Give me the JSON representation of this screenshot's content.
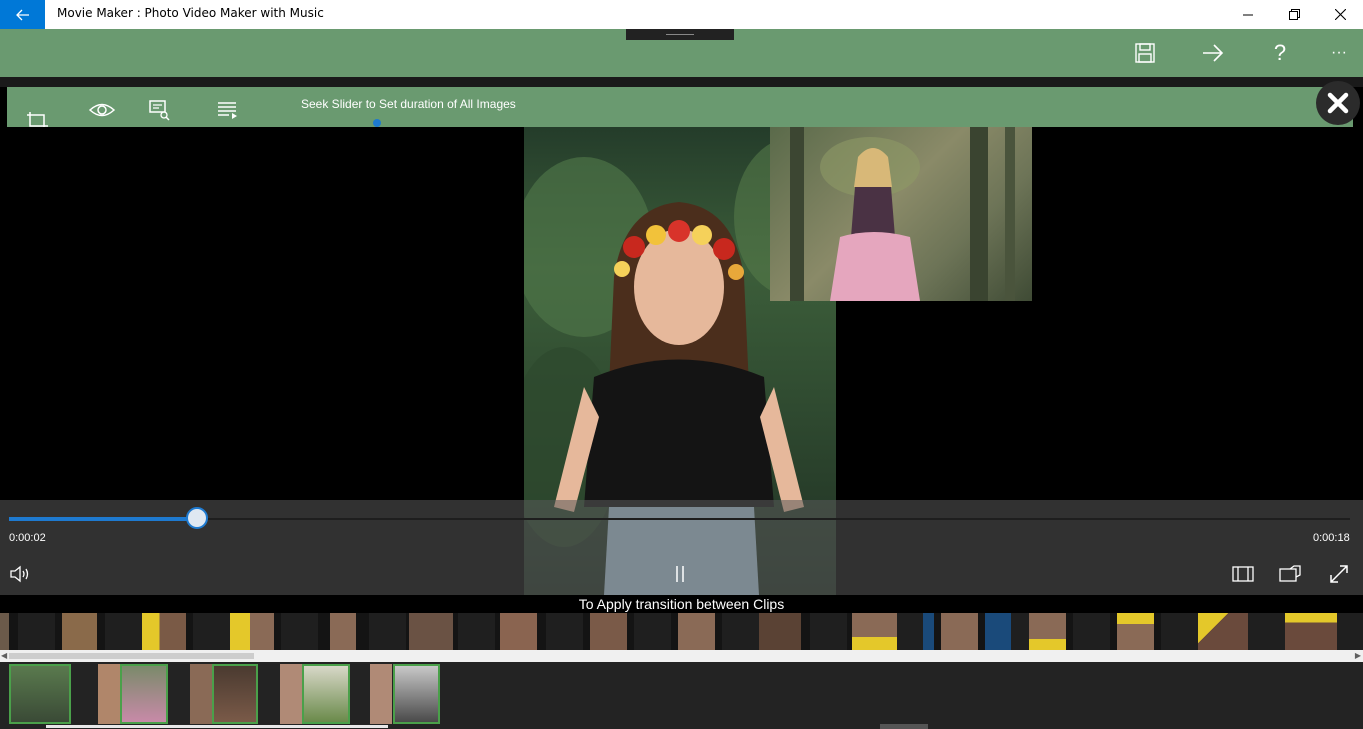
{
  "app": {
    "title": "Movie Maker : Photo Video Maker with Music"
  },
  "window_controls": [
    "minimize-icon",
    "restore-icon",
    "close-icon"
  ],
  "toolbar": {
    "actions": [
      "save-icon",
      "next-arrow-icon",
      "help-icon",
      "more-icon"
    ],
    "help_glyph": "?",
    "more_glyph": "···"
  },
  "editor": {
    "tools": [
      "crop-icon",
      "eye-icon",
      "image-search-icon",
      "playlist-icon"
    ],
    "hint": "Seek Slider to Set duration of All Images"
  },
  "player": {
    "current_time": "0:00:02",
    "total_time": "0:00:18",
    "progress": 0.14,
    "state": "playing"
  },
  "transitions": {
    "label": "To Apply transition between Clips"
  },
  "colors": {
    "accent": "#0078d7",
    "toolbar": "#6a9a70",
    "slider": "#1e7ad0"
  }
}
